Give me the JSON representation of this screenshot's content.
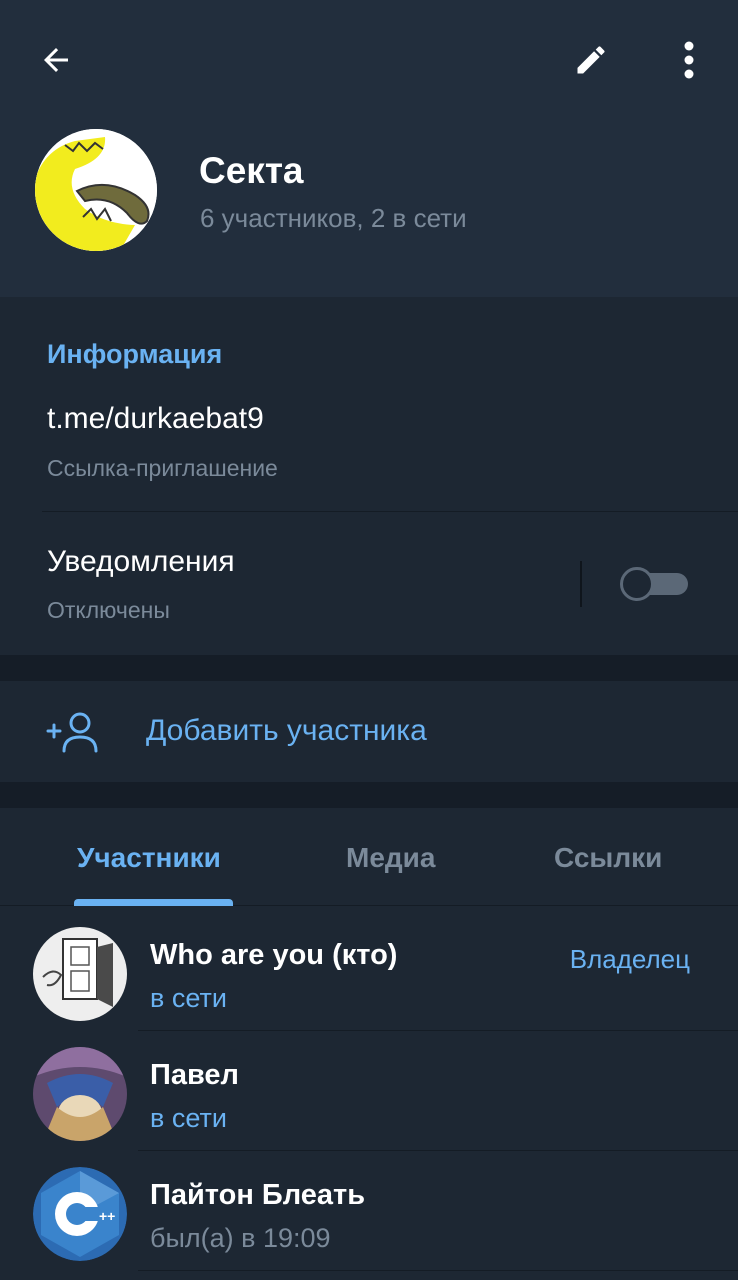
{
  "header": {
    "title": "Секта",
    "subtitle": "6 участников, 2 в сети"
  },
  "info": {
    "section_title": "Информация",
    "invite_link": "t.me/durkaebat9",
    "invite_link_caption": "Ссылка-приглашение",
    "notifications_label": "Уведомления",
    "notifications_state": "Отключены",
    "notifications_enabled": false
  },
  "add_member": {
    "label": "Добавить участника"
  },
  "tabs": [
    {
      "label": "Участники",
      "active": true
    },
    {
      "label": "Медиа",
      "active": false
    },
    {
      "label": "Ссылки",
      "active": false
    }
  ],
  "members": [
    {
      "name": "Who are you (кто)",
      "status": "в сети",
      "role": "Владелец",
      "online": true
    },
    {
      "name": "Павел",
      "status": "в сети",
      "role": "",
      "online": true
    },
    {
      "name": "Пайтон Блеать",
      "status": "был(а) в 19:09",
      "role": "",
      "online": false
    }
  ],
  "colors": {
    "accent": "#6ab2f2",
    "header_bg": "#222e3d",
    "page_bg": "#1d2733",
    "secondary_text": "#7b8a9a"
  },
  "icons": {
    "back": "arrow-left-icon",
    "edit": "pencil-icon",
    "more": "more-vertical-icon",
    "add_member": "add-user-icon"
  }
}
